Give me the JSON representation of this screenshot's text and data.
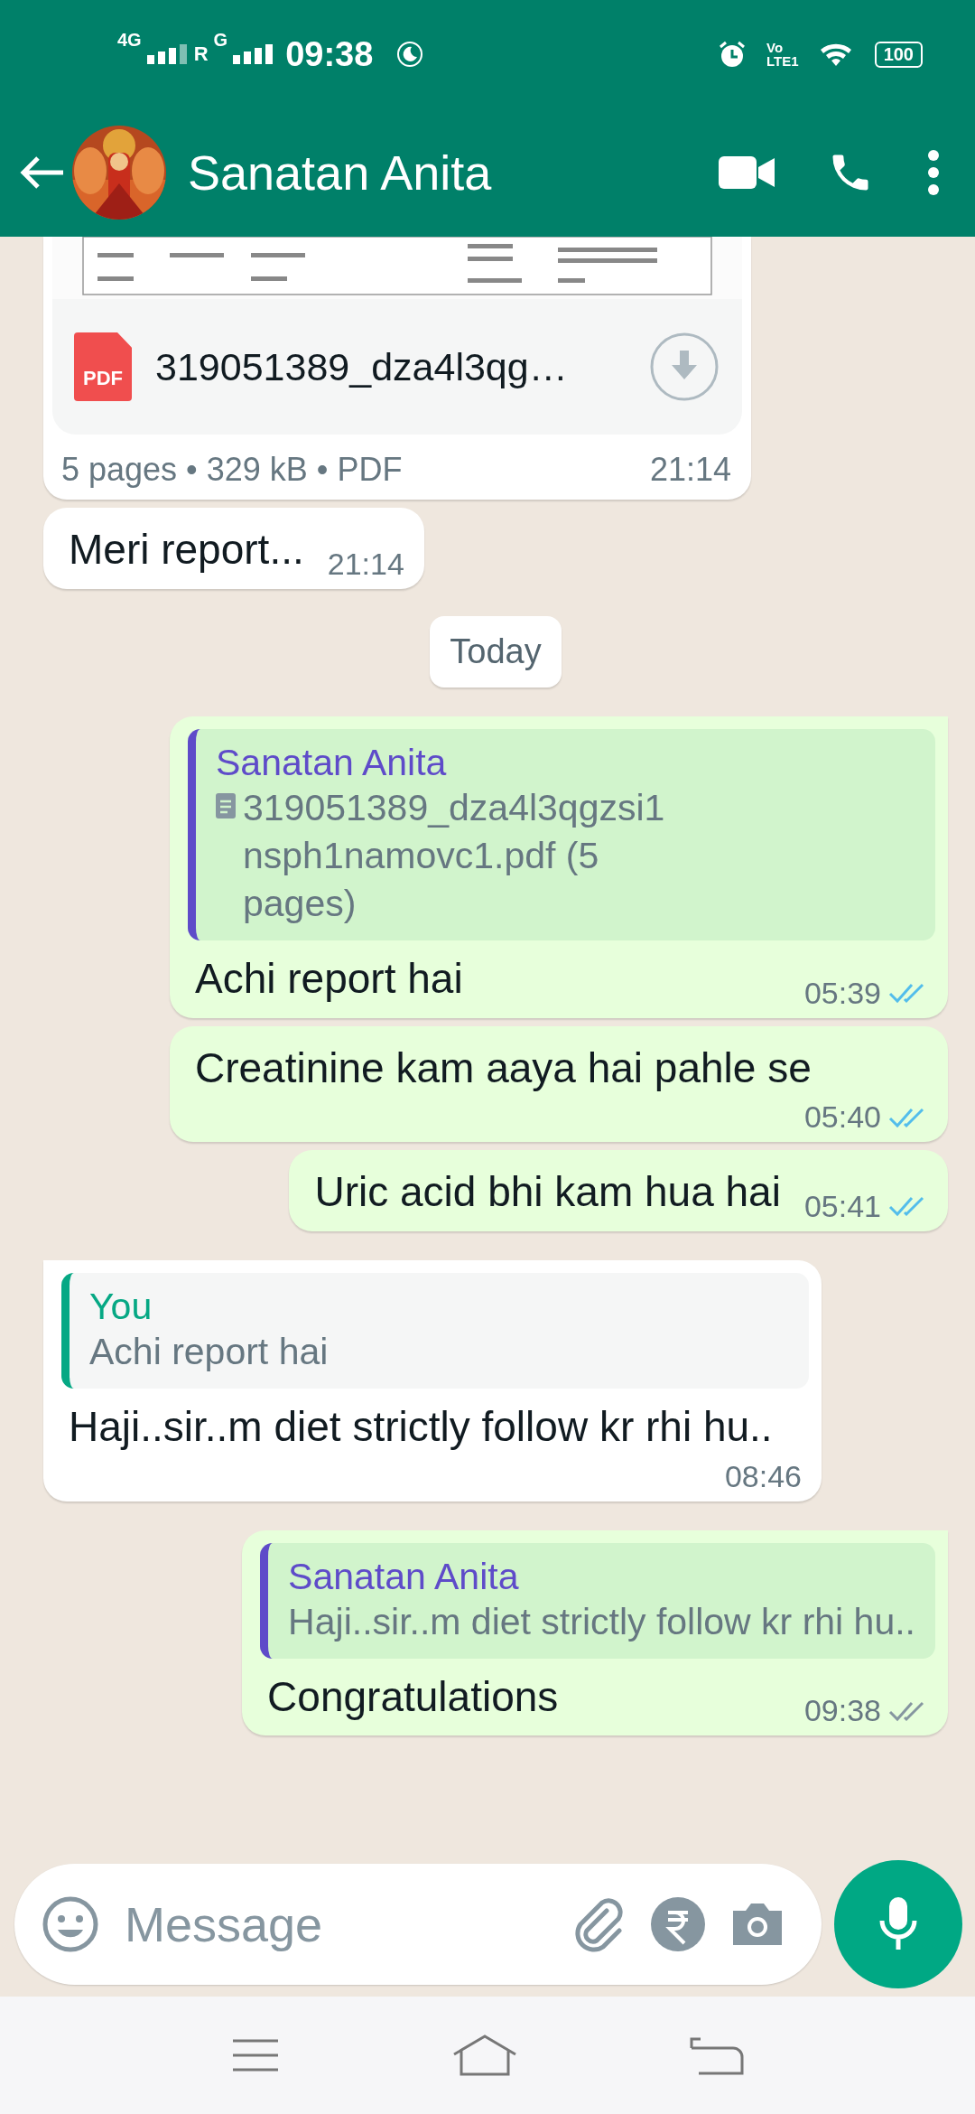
{
  "status_bar": {
    "sim_1": "4G",
    "sim_2_roaming": "R",
    "sim_2": "G",
    "time": "09:38",
    "volte": "Vo",
    "lte": "LTE1",
    "battery": "100"
  },
  "header": {
    "contact_name": "Sanatan Anita"
  },
  "messages": [
    {
      "kind": "document",
      "outgoing": false,
      "icon_label": "PDF",
      "file_name": "319051389_dza4l3qg…",
      "meta": "5 pages • 329 kB • PDF",
      "time": "21:14"
    },
    {
      "kind": "text",
      "outgoing": false,
      "tail": false,
      "text": "Meri report...",
      "time": "21:14"
    },
    {
      "kind": "date",
      "text": "Today"
    },
    {
      "kind": "text",
      "outgoing": true,
      "tail": true,
      "quote": {
        "author": "Sanatan Anita",
        "color": "#5e4bc9",
        "file": true,
        "text": "319051389_dza4l3qgzsi1nsph1namovc1.pdf (5 pages)"
      },
      "text": "Achi report hai",
      "time": "05:39",
      "read": true
    },
    {
      "kind": "text",
      "outgoing": true,
      "tail": false,
      "text": "Creatinine kam aaya hai pahle se",
      "time": "05:40",
      "read": true
    },
    {
      "kind": "text",
      "outgoing": true,
      "tail": false,
      "text": "Uric acid bhi kam hua hai",
      "time": "05:41",
      "read": true
    },
    {
      "kind": "text",
      "outgoing": false,
      "tail": true,
      "quote": {
        "author": "You",
        "color": "#06a884",
        "file": false,
        "text": "Achi report hai"
      },
      "text": "Haji..sir..m diet strictly follow kr rhi hu..",
      "time": "08:46"
    },
    {
      "kind": "text",
      "outgoing": true,
      "tail": true,
      "quote": {
        "author": "Sanatan Anita",
        "color": "#5e4bc9",
        "file": false,
        "text": "Haji..sir..m diet strictly follow kr rhi hu.."
      },
      "text": "Congratulations",
      "time": "09:38",
      "read": false
    }
  ],
  "composer": {
    "placeholder": "Message"
  }
}
